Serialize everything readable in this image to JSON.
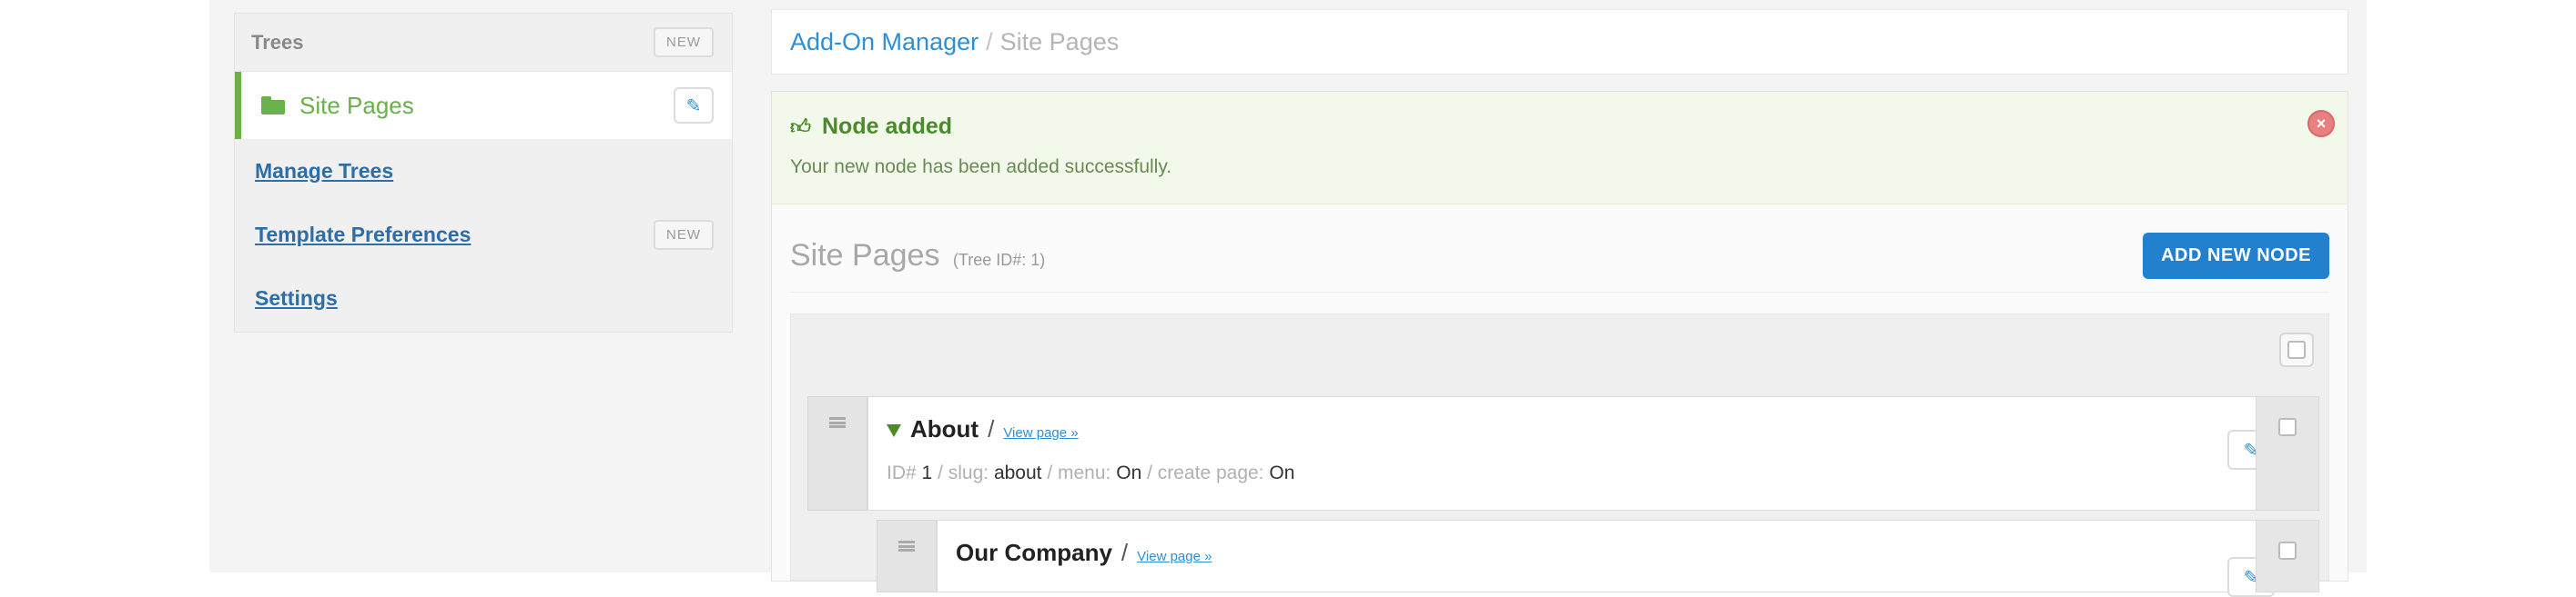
{
  "sidebar": {
    "header": {
      "title": "Trees",
      "badge": "NEW"
    },
    "active": {
      "label": "Site Pages",
      "icon": "folder-icon"
    },
    "links": [
      {
        "label": "Manage Trees",
        "badge": ""
      },
      {
        "label": "Template Preferences",
        "badge": "NEW"
      },
      {
        "label": "Settings",
        "badge": ""
      }
    ]
  },
  "breadcrumb": {
    "link": "Add-On Manager",
    "separator": "/",
    "current": "Site Pages"
  },
  "alert": {
    "title": "Node added",
    "message": "Your new node has been added successfully.",
    "icon": "thumbs-up-icon"
  },
  "section": {
    "title": "Site Pages",
    "subtitle": "(Tree ID#: 1)",
    "add_button": "ADD NEW NODE"
  },
  "nodes": [
    {
      "title": "About",
      "slash": "/",
      "view_link": "View page »",
      "meta": {
        "id_label": "ID#",
        "id": "1",
        "slug_label": "/ slug:",
        "slug": "about",
        "menu_label": "/ menu:",
        "menu": "On",
        "create_label": "/ create page:",
        "create": "On"
      }
    },
    {
      "title": "Our Company",
      "slash": "/",
      "view_link": "View page »"
    }
  ],
  "colors": {
    "accent_green": "#6ab04c",
    "primary_blue": "#2380cf",
    "link_blue": "#2d8fd5"
  }
}
